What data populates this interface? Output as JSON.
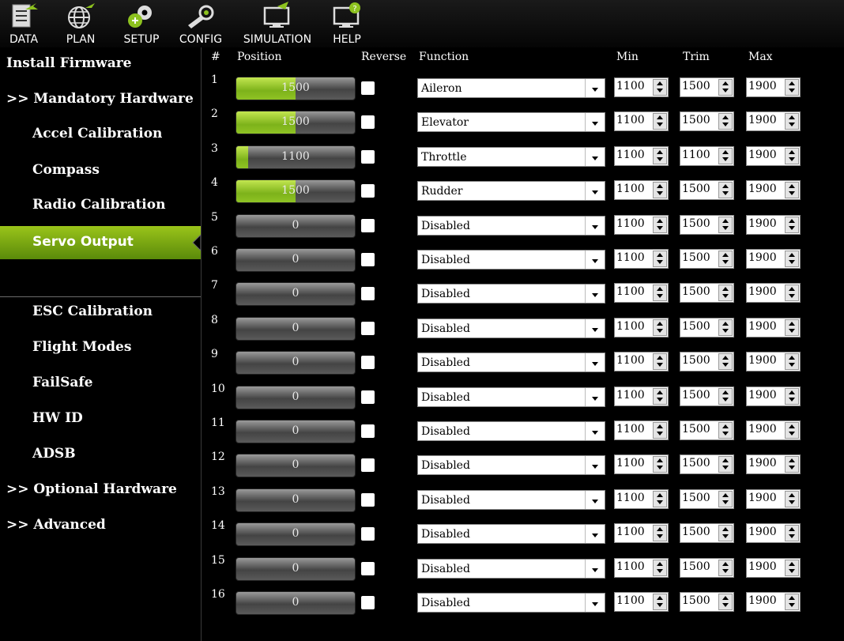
{
  "toolbar": {
    "items": [
      {
        "label": "DATA",
        "icon": "data-icon"
      },
      {
        "label": "PLAN",
        "icon": "globe-icon"
      },
      {
        "label": "SETUP",
        "icon": "gears-icon"
      },
      {
        "label": "CONFIG",
        "icon": "wrench-icon"
      },
      {
        "label": "SIMULATION",
        "icon": "monitor-plane-icon"
      },
      {
        "label": "HELP",
        "icon": "monitor-help-icon"
      }
    ]
  },
  "sidebar": {
    "items": [
      {
        "label": "Install Firmware"
      },
      {
        "label": ">> Mandatory Hardware"
      },
      {
        "label": "Accel Calibration"
      },
      {
        "label": "Compass"
      },
      {
        "label": "Radio Calibration"
      },
      {
        "label": "Servo Output",
        "active": true
      },
      {
        "label": "ESC Calibration"
      },
      {
        "label": "Flight Modes"
      },
      {
        "label": "FailSafe"
      },
      {
        "label": "HW ID"
      },
      {
        "label": "ADSB"
      },
      {
        "label": ">> Optional Hardware"
      },
      {
        "label": ">> Advanced"
      }
    ]
  },
  "table": {
    "headers": {
      "num": "#",
      "position": "Position",
      "reverse": "Reverse",
      "function": "Function",
      "min": "Min",
      "trim": "Trim",
      "max": "Max"
    },
    "pwm_range": [
      1000,
      2000
    ],
    "rows": [
      {
        "num": "1",
        "position": "1500",
        "function": "Aileron",
        "min": "1100",
        "trim": "1500",
        "max": "1900"
      },
      {
        "num": "2",
        "position": "1500",
        "function": "Elevator",
        "min": "1100",
        "trim": "1500",
        "max": "1900"
      },
      {
        "num": "3",
        "position": "1100",
        "function": "Throttle",
        "min": "1100",
        "trim": "1100",
        "max": "1900"
      },
      {
        "num": "4",
        "position": "1500",
        "function": "Rudder",
        "min": "1100",
        "trim": "1500",
        "max": "1900"
      },
      {
        "num": "5",
        "position": "0",
        "function": "Disabled",
        "min": "1100",
        "trim": "1500",
        "max": "1900"
      },
      {
        "num": "6",
        "position": "0",
        "function": "Disabled",
        "min": "1100",
        "trim": "1500",
        "max": "1900"
      },
      {
        "num": "7",
        "position": "0",
        "function": "Disabled",
        "min": "1100",
        "trim": "1500",
        "max": "1900"
      },
      {
        "num": "8",
        "position": "0",
        "function": "Disabled",
        "min": "1100",
        "trim": "1500",
        "max": "1900"
      },
      {
        "num": "9",
        "position": "0",
        "function": "Disabled",
        "min": "1100",
        "trim": "1500",
        "max": "1900"
      },
      {
        "num": "10",
        "position": "0",
        "function": "Disabled",
        "min": "1100",
        "trim": "1500",
        "max": "1900"
      },
      {
        "num": "11",
        "position": "0",
        "function": "Disabled",
        "min": "1100",
        "trim": "1500",
        "max": "1900"
      },
      {
        "num": "12",
        "position": "0",
        "function": "Disabled",
        "min": "1100",
        "trim": "1500",
        "max": "1900"
      },
      {
        "num": "13",
        "position": "0",
        "function": "Disabled",
        "min": "1100",
        "trim": "1500",
        "max": "1900"
      },
      {
        "num": "14",
        "position": "0",
        "function": "Disabled",
        "min": "1100",
        "trim": "1500",
        "max": "1900"
      },
      {
        "num": "15",
        "position": "0",
        "function": "Disabled",
        "min": "1100",
        "trim": "1500",
        "max": "1900"
      },
      {
        "num": "16",
        "position": "0",
        "function": "Disabled",
        "min": "1100",
        "trim": "1500",
        "max": "1900"
      }
    ]
  },
  "colors": {
    "accent": "#8dc21f",
    "background": "#000000"
  }
}
